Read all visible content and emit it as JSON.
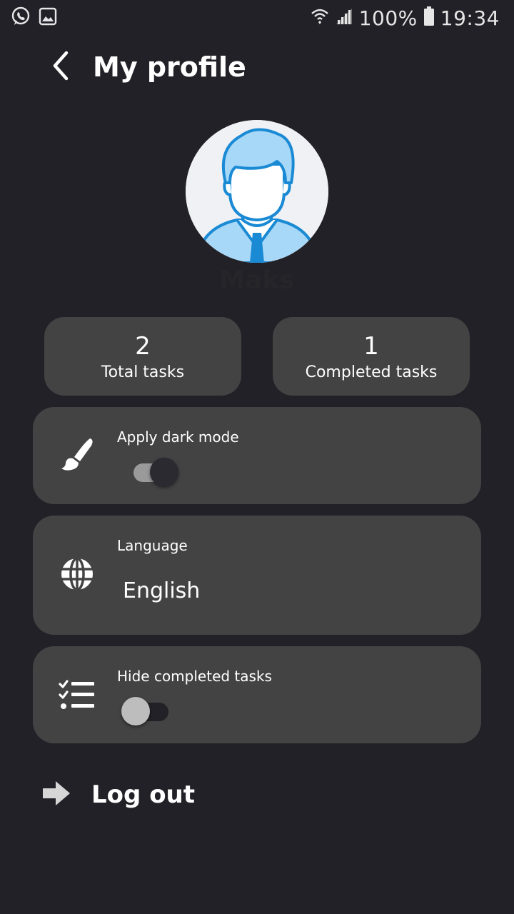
{
  "status_bar": {
    "battery": "100%",
    "time": "19:34",
    "icons": [
      "whatsapp-icon",
      "image-icon",
      "wifi-icon",
      "signal-icon",
      "battery-icon"
    ]
  },
  "header": {
    "title": "My profile",
    "back_icon": "chevron-left-icon"
  },
  "profile": {
    "name": "Maks",
    "avatar_icon": "user-avatar-icon"
  },
  "stats": [
    {
      "value": "2",
      "label": "Total tasks"
    },
    {
      "value": "1",
      "label": "Completed tasks"
    }
  ],
  "settings": {
    "dark_mode": {
      "label": "Apply dark mode",
      "icon": "paintbrush-icon",
      "enabled": true
    },
    "language": {
      "label": "Language",
      "value": "English",
      "icon": "globe-icon"
    },
    "hide_completed": {
      "label": "Hide completed tasks",
      "icon": "checklist-icon",
      "enabled": false
    }
  },
  "logout": {
    "label": "Log out",
    "icon": "arrow-right-icon"
  },
  "colors": {
    "background": "#222127",
    "card": "#434343",
    "toggle_on_thumb": "#2b2a30",
    "toggle_on_track": "#9a9a9a",
    "toggle_off_thumb": "#bdbdbd",
    "toggle_off_track": "#222127",
    "avatar_blue": "#1a8ad4"
  }
}
